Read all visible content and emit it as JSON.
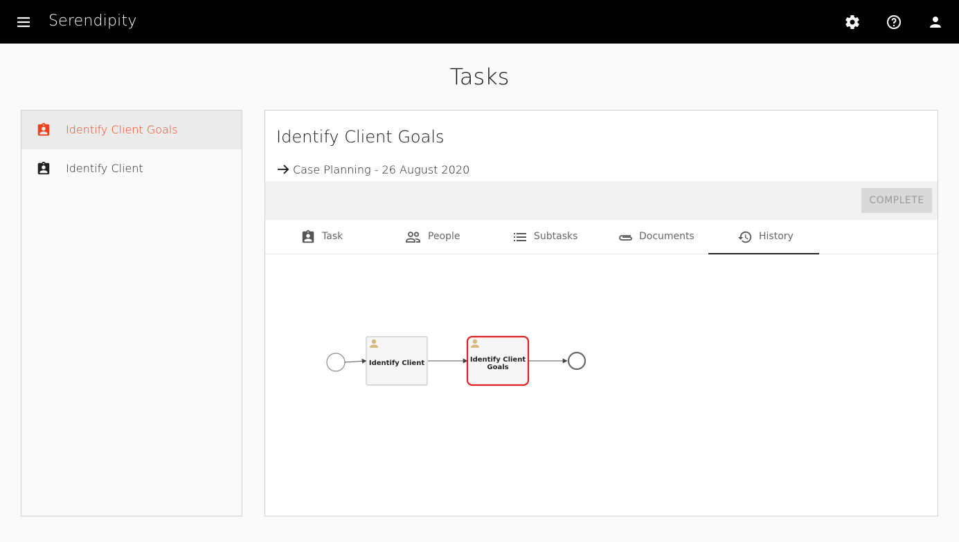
{
  "app": {
    "title": "Serendipity"
  },
  "header": {
    "icons": [
      "menu-icon",
      "settings-icon",
      "help-icon",
      "account-icon"
    ]
  },
  "page": {
    "title": "Tasks"
  },
  "sidebar": {
    "items": [
      {
        "label": "Identify Client Goals",
        "icon": "assignment-ind-icon",
        "active": true
      },
      {
        "label": "Identify Client",
        "icon": "assignment-ind-icon",
        "active": false
      }
    ]
  },
  "task": {
    "title": "Identify Client Goals",
    "case_link": "Case Planning - 26 August 2020",
    "complete_label": "COMPLETE"
  },
  "tabs": [
    {
      "label": "Task",
      "icon": "assignment-ind-icon"
    },
    {
      "label": "People",
      "icon": "people-icon"
    },
    {
      "label": "Subtasks",
      "icon": "list-icon"
    },
    {
      "label": "Documents",
      "icon": "attachment-icon"
    },
    {
      "label": "History",
      "icon": "history-icon",
      "active": true
    }
  ],
  "diagram": {
    "nodes": [
      {
        "label": "Identify Client",
        "state": "completed"
      },
      {
        "label": "Identify Client Goals",
        "state": "active"
      }
    ],
    "colors": {
      "active_border": "#e02020",
      "accent": "#e8431e"
    }
  }
}
